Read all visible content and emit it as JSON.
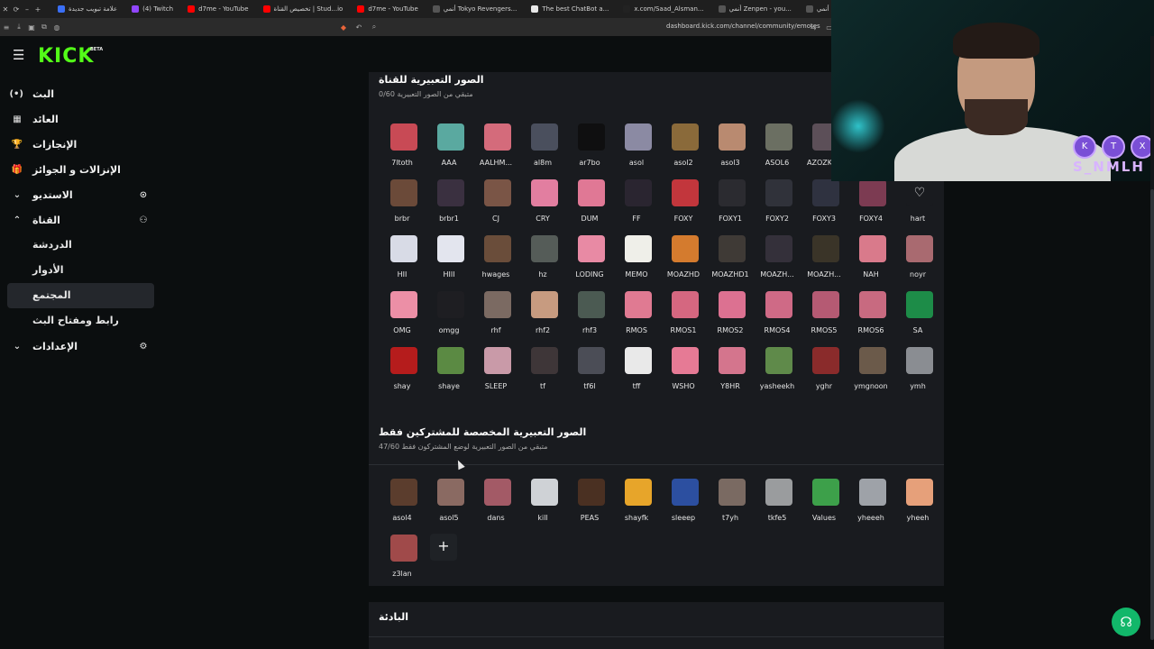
{
  "browser": {
    "tabs": [
      {
        "label": "علامة تبويب جديدة",
        "color": "#3a6ff7"
      },
      {
        "label": "(4) Twitch",
        "color": "#9146ff"
      },
      {
        "label": "d7me - YouTube",
        "color": "#ff0000"
      },
      {
        "label": "تخصيص القناة | Stud...io",
        "color": "#ff0000"
      },
      {
        "label": "d7me - YouTube",
        "color": "#ff0000"
      },
      {
        "label": "أنمي Tokyo Revengers...",
        "color": "#555555"
      },
      {
        "label": "The best ChatBot a...",
        "color": "#e8e8e8"
      },
      {
        "label": "x.com/Saad_Alsman...",
        "color": "#222222"
      },
      {
        "label": "أنمي Zenpen - you...",
        "color": "#555555"
      },
      {
        "label": "أنمي Karakuri Circus...",
        "color": "#555555"
      },
      {
        "label": "Anime4up |",
        "color": "#555555"
      }
    ],
    "url": "dashboard.kick.com/channel/community/emotes"
  },
  "logo": {
    "text": "KICK",
    "badge": "BETA"
  },
  "sidebar": {
    "items": [
      {
        "label": "البث",
        "icon": "broadcast-icon",
        "glyph": "(•)"
      },
      {
        "label": "العائد",
        "icon": "revenue-icon",
        "glyph": "▦"
      },
      {
        "label": "الإنجازات",
        "icon": "trophy-icon",
        "glyph": "🏆"
      },
      {
        "label": "الإنزالات و الجوائز",
        "icon": "gift-icon",
        "glyph": "🎁"
      },
      {
        "label": "الاستديو",
        "icon": "studio-icon",
        "glyph": "⊙",
        "chevron": "⌄"
      },
      {
        "label": "القناة",
        "icon": "channel-icon",
        "glyph": "⚇",
        "chevron": "⌃"
      }
    ],
    "channel_sub": [
      {
        "label": "الدردشة"
      },
      {
        "label": "الأدوار"
      },
      {
        "label": "المجتمع",
        "active": true
      },
      {
        "label": "رابط ومفتاح البث"
      }
    ],
    "settings": {
      "label": "الإعدادات",
      "icon": "gear-icon",
      "glyph": "⚙",
      "chevron": "⌄"
    }
  },
  "channel_emotes": {
    "title": "الصور التعبيرية للقناة",
    "subtitle": "0/60 متبقي من الصور التعبيرية",
    "emotes": [
      {
        "name": "7ltoth",
        "color": "#c84a55"
      },
      {
        "name": "AAA",
        "color": "#5aa9a0"
      },
      {
        "name": "AALHM...",
        "color": "#d46b7b"
      },
      {
        "name": "al8m",
        "color": "#4a4f5d"
      },
      {
        "name": "ar7bo",
        "color": "#0f0f10"
      },
      {
        "name": "asol",
        "color": "#8b8aa3"
      },
      {
        "name": "asol2",
        "color": "#8a6a3a"
      },
      {
        "name": "asol3",
        "color": "#b98a70"
      },
      {
        "name": "ASOL6",
        "color": "#6b6f62"
      },
      {
        "name": "AZOZKI...",
        "color": "#5c4f58"
      },
      {
        "name": "brbr",
        "color": "#6b4a39"
      },
      {
        "name": "brbr1",
        "color": "#3a3040"
      },
      {
        "name": "CJ",
        "color": "#7a5546"
      },
      {
        "name": "CRY",
        "color": "#e27ea0"
      },
      {
        "name": "DUM",
        "color": "#e07895"
      },
      {
        "name": "FF",
        "color": "#2a2530"
      },
      {
        "name": "FOXY",
        "color": "#c2363c"
      },
      {
        "name": "FOXY1",
        "color": "#2b2b30"
      },
      {
        "name": "FOXY2",
        "color": "#30323a"
      },
      {
        "name": "FOXY3",
        "color": "#2f3240"
      },
      {
        "name": "FOXY4",
        "color": "#7c3b52"
      },
      {
        "name": "hart",
        "color": "#191b1f"
      },
      {
        "name": "HII",
        "color": "#d8dbe6"
      },
      {
        "name": "HIII",
        "color": "#e3e5ee"
      },
      {
        "name": "hwages",
        "color": "#6a4d3a"
      },
      {
        "name": "hz",
        "color": "#555c58"
      },
      {
        "name": "LODING",
        "color": "#e88aa4"
      },
      {
        "name": "MEMO",
        "color": "#efefe9"
      },
      {
        "name": "MOAZHD",
        "color": "#d47b2e"
      },
      {
        "name": "MOAZHD1",
        "color": "#3f3a36"
      },
      {
        "name": "MOAZH...",
        "color": "#34303a"
      },
      {
        "name": "MOAZH...",
        "color": "#3a3428"
      },
      {
        "name": "NAH",
        "color": "#d97a8b"
      },
      {
        "name": "noyr",
        "color": "#a96a70"
      },
      {
        "name": "OMG",
        "color": "#ec8fa6"
      },
      {
        "name": "omgg",
        "color": "#1e1e22"
      },
      {
        "name": "rhf",
        "color": "#7b6a62"
      },
      {
        "name": "rhf2",
        "color": "#c79b80"
      },
      {
        "name": "rhf3",
        "color": "#4b5a52"
      },
      {
        "name": "RMOS",
        "color": "#e07a92"
      },
      {
        "name": "RMOS1",
        "color": "#d56780"
      },
      {
        "name": "RMOS2",
        "color": "#dc7191"
      },
      {
        "name": "RMOS4",
        "color": "#cf6a86"
      },
      {
        "name": "RMOS5",
        "color": "#b55a73"
      },
      {
        "name": "RMOS6",
        "color": "#c86a80"
      },
      {
        "name": "SA",
        "color": "#1d8c48"
      },
      {
        "name": "shay",
        "color": "#b51c1c"
      },
      {
        "name": "shaye",
        "color": "#5b8a43"
      },
      {
        "name": "SLEEP",
        "color": "#c99aa8"
      },
      {
        "name": "tf",
        "color": "#3e3638"
      },
      {
        "name": "tf6l",
        "color": "#4b4d56"
      },
      {
        "name": "tff",
        "color": "#e9e9e9"
      },
      {
        "name": "WSHO",
        "color": "#e67a95"
      },
      {
        "name": "Y8HR",
        "color": "#d4758d"
      },
      {
        "name": "yasheekh",
        "color": "#5f8a4a"
      },
      {
        "name": "yghr",
        "color": "#8a2b2b"
      },
      {
        "name": "ymgnoon",
        "color": "#6b5a4a"
      },
      {
        "name": "ymh",
        "color": "#8a8d92"
      }
    ]
  },
  "sub_emotes": {
    "title": "الصور التعبيرية المخصصة للمشتركين فقط",
    "subtitle": "47/60 متبقي من الصور التعبيرية لوضع المشتركون فقط",
    "emotes": [
      {
        "name": "asol4",
        "color": "#5b3d2d"
      },
      {
        "name": "asol5",
        "color": "#8a6a62"
      },
      {
        "name": "dans",
        "color": "#a35a66"
      },
      {
        "name": "kill",
        "color": "#cfd2d6"
      },
      {
        "name": "PEAS",
        "color": "#4a3022"
      },
      {
        "name": "shayfk",
        "color": "#e7a52a"
      },
      {
        "name": "sleeep",
        "color": "#2c4fa0"
      },
      {
        "name": "t7yh",
        "color": "#7a6a62"
      },
      {
        "name": "tkfe5",
        "color": "#9a9c9e"
      },
      {
        "name": "Values",
        "color": "#3da04a"
      },
      {
        "name": "yheeeh",
        "color": "#9ea2a8"
      },
      {
        "name": "yheeh",
        "color": "#e6a07a"
      },
      {
        "name": "z3lan",
        "color": "#a04a4a"
      }
    ],
    "add_label": "+"
  },
  "bottom_section": {
    "title": "البادئة"
  },
  "webcam": {
    "handle": "S_NMLH",
    "badges": [
      "kick-badge",
      "twitch-badge",
      "kick-badge"
    ]
  },
  "help": {
    "icon": "headset-icon"
  }
}
